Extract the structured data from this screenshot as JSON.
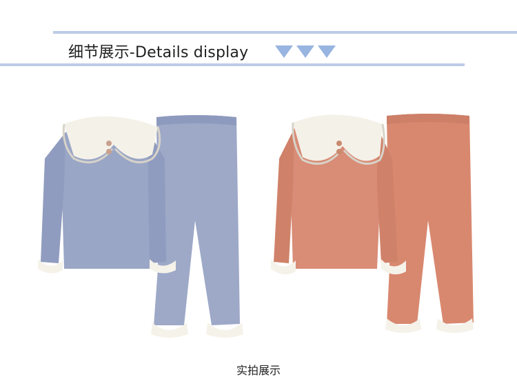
{
  "header": {
    "title": "细节展示-Details display",
    "arrow_icon": "triangle-down-icon"
  },
  "products": [
    {
      "color_name": "blue",
      "top_color": "#9aa6c6",
      "pants_color": "#9ea9c8"
    },
    {
      "color_name": "coral",
      "top_color": "#d98c76",
      "pants_color": "#d8886f"
    }
  ],
  "caption": "实拍展示",
  "colors": {
    "rule": "#bccbe7",
    "arrow": "#98b4e0",
    "collar": "#f4f1e9"
  }
}
